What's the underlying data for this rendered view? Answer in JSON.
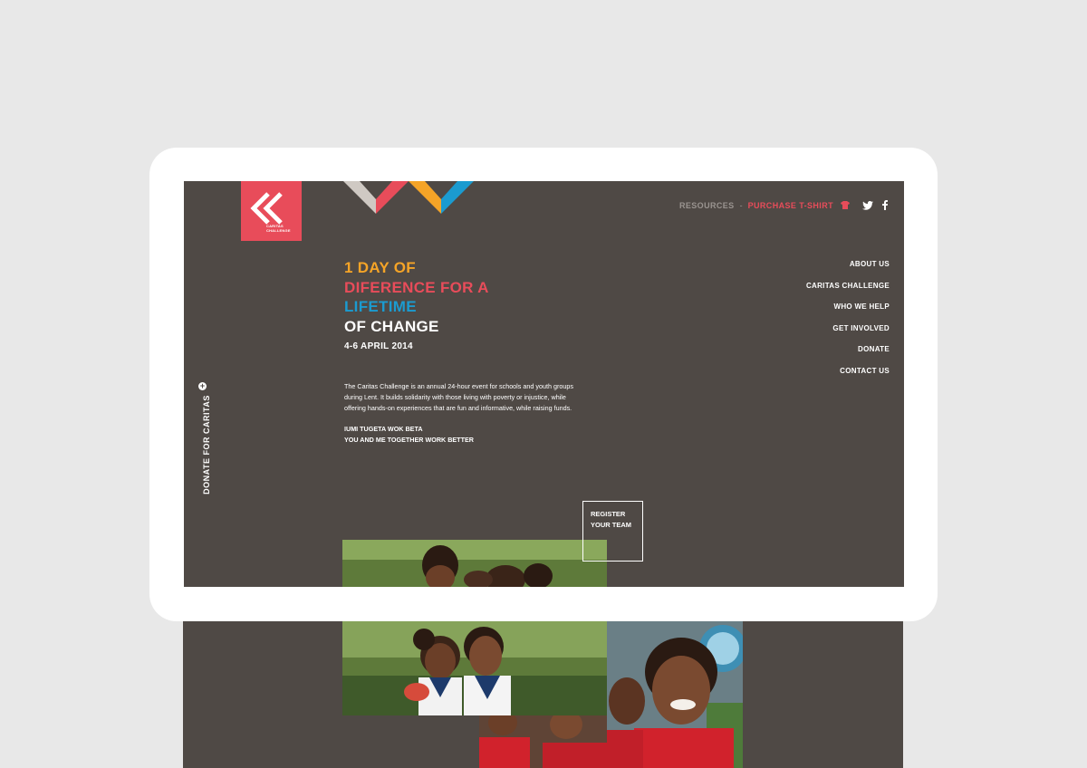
{
  "logo": {
    "line1": "CARITAS",
    "line2": "CHALLENGE"
  },
  "top_nav": {
    "resources": "RESOURCES",
    "separator": "-",
    "purchase": "PURCHASE T-SHIRT",
    "icons": [
      "tshirt-icon",
      "twitter-icon",
      "facebook-icon"
    ]
  },
  "side_nav": [
    "ABOUT US",
    "CARITAS CHALLENGE",
    "WHO WE HELP",
    "GET INVOLVED",
    "DONATE",
    "CONTACT US"
  ],
  "donate_tab": {
    "label": "DONATE FOR CARITAS",
    "icon": "plus-circle-icon"
  },
  "headline": {
    "line1": "1 DAY OF",
    "line2": "DIFERENCE FOR A",
    "line3": "LIFETIME",
    "line4": "OF CHANGE"
  },
  "date": "4-6 APRIL 2014",
  "intro": {
    "line1": "The Caritas Challenge is an annual 24-hour event for schools and youth groups",
    "line2": "during Lent. It builds solidarity with those living with poverty or injustice, while",
    "line3": "offering hands-on experiences that are fun and informative, while raising funds."
  },
  "motto": {
    "line1": "IUMI TUGETA WOK BETA",
    "line2": "YOU AND ME TOGETHER WORK BETTER"
  },
  "register": {
    "line1": "REGISTER",
    "line2": "YOUR TEAM"
  },
  "colors": {
    "background": "#4f4945",
    "brand_red": "#e84c5a",
    "orange": "#f5a427",
    "blue": "#1b9bd0",
    "page_bg": "#e8e8e8"
  }
}
